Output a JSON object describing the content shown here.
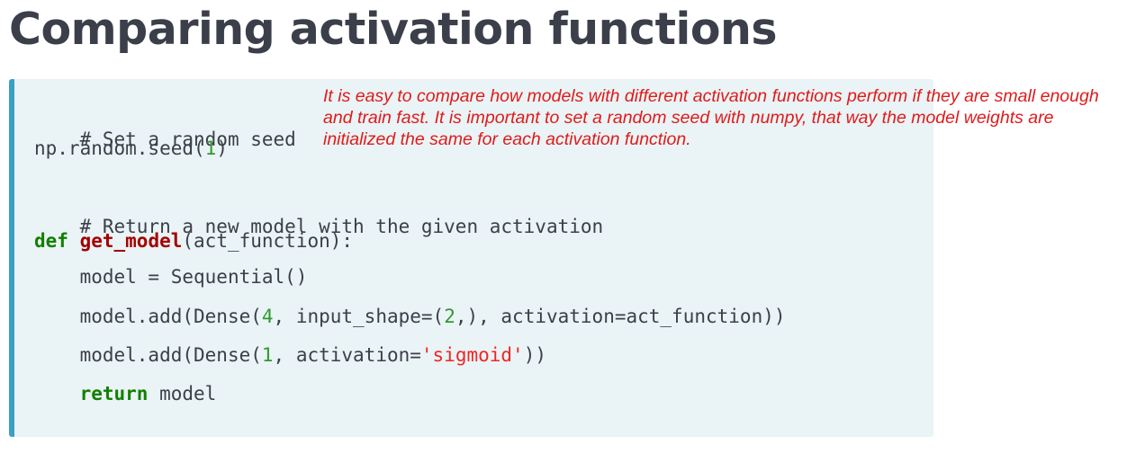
{
  "slide": {
    "title": "Comparing activation functions"
  },
  "note": {
    "text": "It is easy to compare how models with different activation functions perform if they are small enough and train fast. It is important to set a random seed with numpy, that way the model weights are initialized the same for each activation function."
  },
  "code": {
    "line1": "# Set a random seed",
    "line2_a": "np.random.seed(",
    "line2_num": "1",
    "line2_b": ")",
    "line3": "# Return a new model with the given activation",
    "line4_kw": "def",
    "line4_fn": "get_model",
    "line4_rest": "(act_function):",
    "line5": "model = Sequential()",
    "line6_a": "model.add(Dense(",
    "line6_num1": "4",
    "line6_b": ", input_shape=(",
    "line6_num2": "2",
    "line6_c": ",), activation=act_function))",
    "line7_a": "model.add(Dense(",
    "line7_num": "1",
    "line7_b": ", activation=",
    "line7_str": "'sigmoid'",
    "line7_c": "))",
    "line8_kw": "return",
    "line8_rest": " model"
  },
  "colors": {
    "title": "#3b3f4a",
    "code_background": "#eaf3f5",
    "code_border": "#3aa0c6",
    "keyword": "#118000",
    "function_name": "#a30000",
    "number": "#2f9a2f",
    "string": "#f02525",
    "note_text": "#e01b1b"
  }
}
